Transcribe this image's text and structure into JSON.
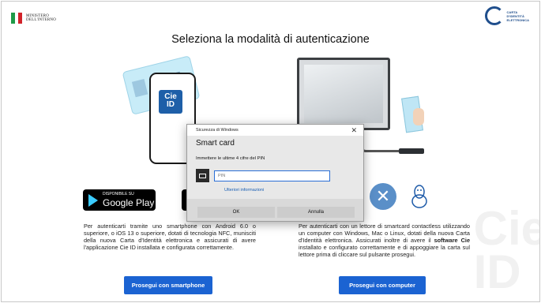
{
  "header": {
    "ministry": "MINISTERO\nDELL'INTERNO",
    "cie_logo_text": "CARTA\nD'IDENTITÀ\nELETTRONICA",
    "title": "Seleziona la modalità di autenticazione"
  },
  "watermark": "Cie\nID",
  "left_panel": {
    "app_badge": "Cie\nID",
    "store_small": "DISPONIBILE SU",
    "store_big": "Google Play",
    "description": "Per autenticarti tramite uno smartphone con Android 6.0 o superiore, o iOS 13 o superiore, dotati di tecnologia NFC, munisciti della nuova Carta d'Identità elettronica e assicurati di avere l'applicazione Cie ID installata e configurata correttamente.",
    "button": "Prosegui con smartphone"
  },
  "right_panel": {
    "description_pre": "Per autenticarti con un lettore di smartcard contactless utilizzando un computer con Windows, Mac o Linux, dotati della nuova Carta d'Identità elettronica. Assicurati inoltre di avere il ",
    "description_bold": "software Cie",
    "description_post": " installato e configurato correttamente e di appoggiare la carta sul lettore prima di cliccare sul pulsante prosegui.",
    "button": "Prosegui con computer"
  },
  "dialog": {
    "window_title": "Sicurezza di Windows",
    "title": "Smart card",
    "message": "Immettere le ultime 4 cifre del PIN",
    "pin_placeholder": "PIN",
    "link": "Ulteriori informazioni",
    "ok": "OK",
    "cancel": "Annulla"
  },
  "colors": {
    "primary_button": "#1b63d2",
    "flag_green": "#1f9a48",
    "flag_red": "#d2232a"
  }
}
